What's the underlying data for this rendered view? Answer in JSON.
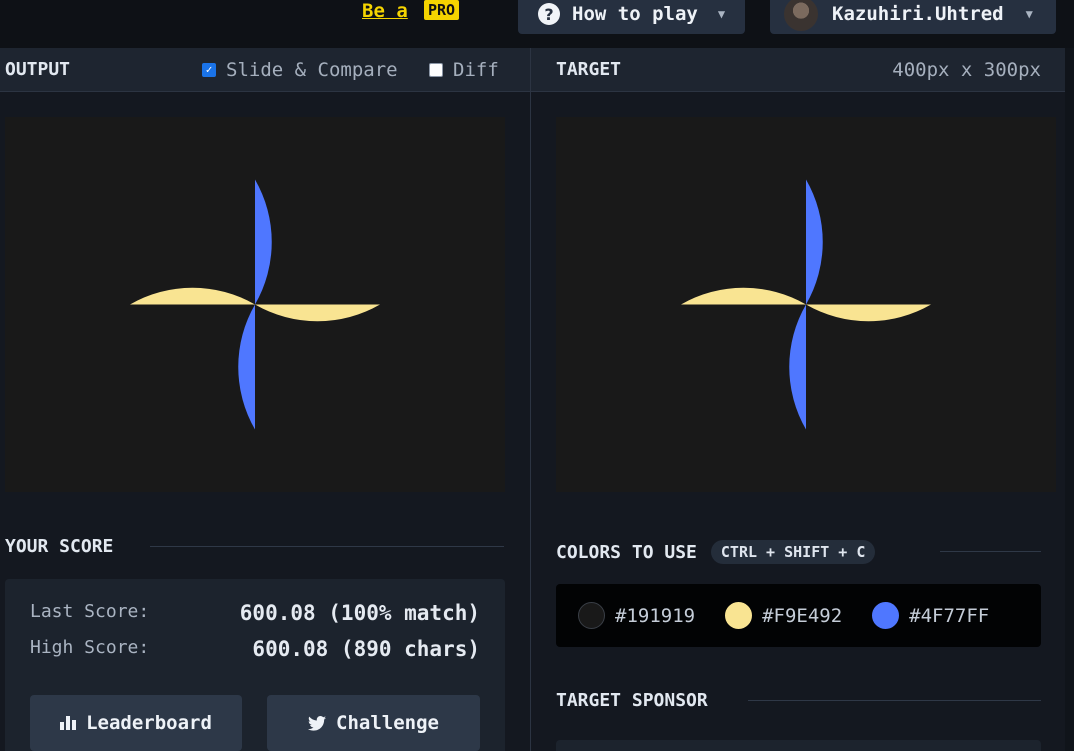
{
  "topbar": {
    "pro_link": "Be a",
    "pro_badge": "PRO",
    "how_to_play": "How to play",
    "username": "Kazuhiri.Uhtred"
  },
  "output_panel": {
    "title": "OUTPUT",
    "slide_compare_label": "Slide & Compare",
    "slide_compare_checked": true,
    "diff_label": "Diff",
    "diff_checked": false
  },
  "target_panel": {
    "title": "TARGET",
    "dimensions": "400px x 300px"
  },
  "score": {
    "title": "YOUR SCORE",
    "last_label": "Last Score:",
    "last_value": "600.08 (100% match)",
    "high_label": "High Score:",
    "high_value": "600.08 (890 chars)",
    "leaderboard_label": "Leaderboard",
    "challenge_label": "Challenge"
  },
  "colors": {
    "title": "COLORS TO USE",
    "shortcut": "CTRL + SHIFT + C",
    "items": [
      {
        "hex": "#191919"
      },
      {
        "hex": "#F9E492"
      },
      {
        "hex": "#4F77FF"
      }
    ]
  },
  "sponsor": {
    "title": "TARGET SPONSOR"
  },
  "palette_colors": {
    "background": "#191919",
    "yellow": "#F9E492",
    "blue": "#4F77FF"
  }
}
